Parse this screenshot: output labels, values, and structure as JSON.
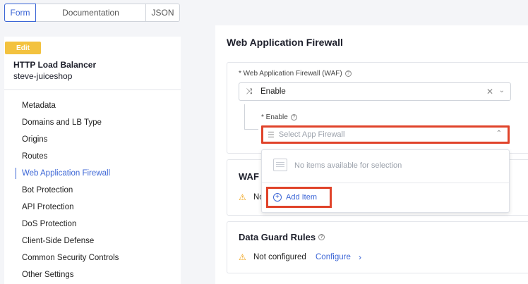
{
  "tabs": {
    "form": "Form",
    "documentation": "Documentation",
    "json": "JSON"
  },
  "sidebar": {
    "badge": "Edit",
    "title": "HTTP Load Balancer",
    "name": "steve-juiceshop",
    "items": [
      {
        "label": "Metadata"
      },
      {
        "label": "Domains and LB Type"
      },
      {
        "label": "Origins"
      },
      {
        "label": "Routes"
      },
      {
        "label": "Web Application Firewall"
      },
      {
        "label": "Bot Protection"
      },
      {
        "label": "API Protection"
      },
      {
        "label": "DoS Protection"
      },
      {
        "label": "Client-Side Defense"
      },
      {
        "label": "Common Security Controls"
      },
      {
        "label": "Other Settings"
      }
    ]
  },
  "main": {
    "title": "Web Application Firewall",
    "waf_label": "* Web Application Firewall (WAF)",
    "waf_value": "Enable",
    "enable_label": "* Enable",
    "app_firewall_placeholder": "Select App Firewall",
    "waf_card_title": "WAF",
    "waf_card_status": "No",
    "data_guard_title": "Data Guard Rules",
    "data_guard_status": "Not configured",
    "data_guard_action": "Configure"
  },
  "dropdown": {
    "empty_text": "No items available for selection",
    "add_label": "Add Item"
  },
  "colors": {
    "accent": "#3c66d6",
    "highlight": "#e0432a",
    "warning": "#f0a41c",
    "badge": "#f3c23f"
  }
}
